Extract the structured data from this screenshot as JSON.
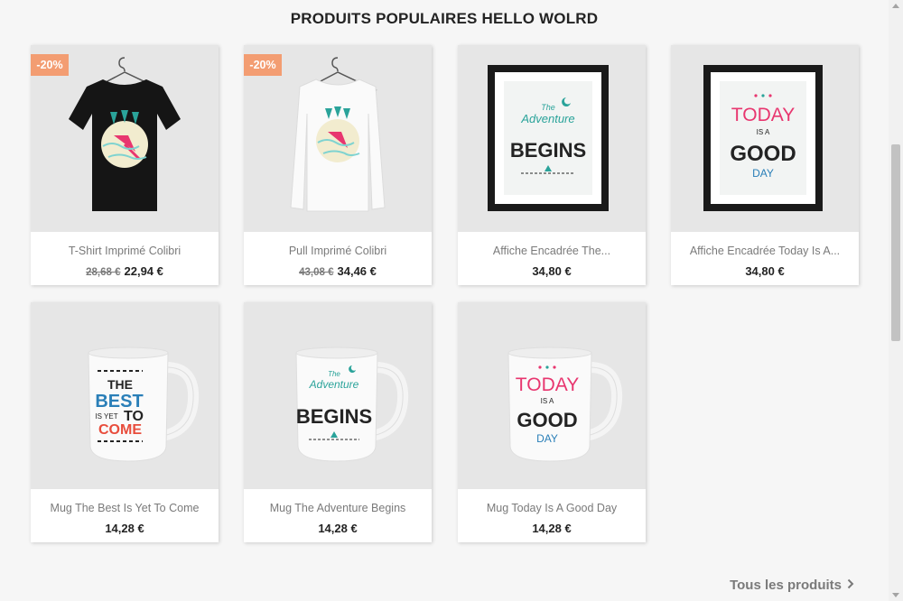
{
  "section": {
    "title": "PRODUITS POPULAIRES HELLO WOLRD"
  },
  "products": [
    {
      "name": "T-Shirt Imprimé Colibri",
      "old_price": "28,68 €",
      "price": "22,94 €",
      "badge": "-20%"
    },
    {
      "name": "Pull Imprimé Colibri",
      "old_price": "43,08 €",
      "price": "34,46 €",
      "badge": "-20%"
    },
    {
      "name": "Affiche Encadrée The...",
      "price": "34,80 €"
    },
    {
      "name": "Affiche Encadrée Today Is A...",
      "price": "34,80 €"
    },
    {
      "name": "Mug The Best Is Yet To Come",
      "price": "14,28 €"
    },
    {
      "name": "Mug The Adventure Begins",
      "price": "14,28 €"
    },
    {
      "name": "Mug Today Is A Good Day",
      "price": "14,28 €"
    }
  ],
  "artwork": {
    "adventure": {
      "the": "The",
      "word": "Adventure",
      "begins": "BEGINS"
    },
    "today": {
      "today": "TODAY",
      "is_a": "IS A",
      "good": "GOOD",
      "day": "DAY"
    },
    "best": {
      "the": "THE",
      "best": "BEST",
      "is_yet": "IS YET",
      "to": "TO",
      "come": "COME"
    }
  },
  "footer": {
    "all_products": "Tous les produits",
    "chevron_icon": "chevron-right-icon"
  },
  "colors": {
    "badge": "#f39d72",
    "teal": "#2aa39a",
    "pink": "#e8366f",
    "dark": "#232323"
  }
}
